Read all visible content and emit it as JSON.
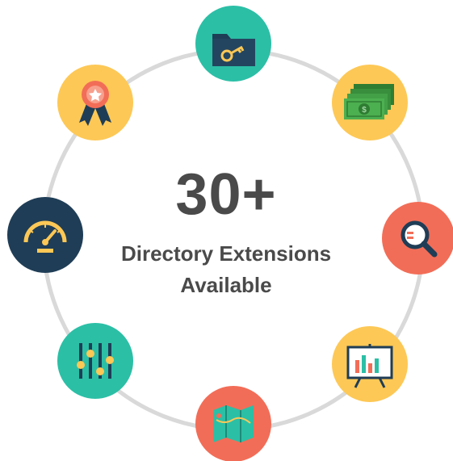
{
  "headline": "30+",
  "subtitle_line1": "Directory Extensions",
  "subtitle_line2": "Available",
  "colors": {
    "ring": "#d9d9d9",
    "teal": "#2bbfa6",
    "yellow": "#fdc856",
    "coral": "#f26d57",
    "navy": "#1f3d56",
    "text": "#4a4a4a"
  },
  "icons": [
    {
      "name": "key-folder-icon",
      "bg": "teal"
    },
    {
      "name": "money-stack-icon",
      "bg": "yellow"
    },
    {
      "name": "search-magnifier-icon",
      "bg": "coral"
    },
    {
      "name": "presentation-chart-icon",
      "bg": "yellow"
    },
    {
      "name": "map-icon",
      "bg": "coral"
    },
    {
      "name": "equalizer-sliders-icon",
      "bg": "teal"
    },
    {
      "name": "speedometer-icon",
      "bg": "navy"
    },
    {
      "name": "award-ribbon-icon",
      "bg": "yellow"
    }
  ]
}
